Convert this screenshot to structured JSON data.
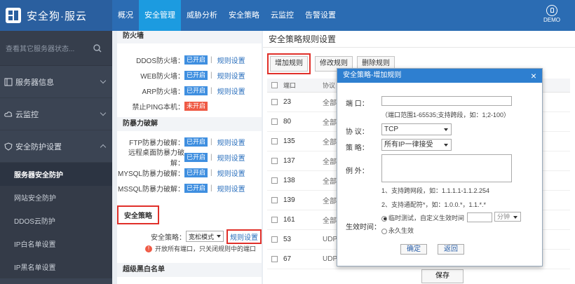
{
  "app": {
    "title": "安全狗·服云"
  },
  "colors": {
    "topbar": "#2b6cb3",
    "active_nav": "#1c9be0",
    "sidebar": "#3b4453",
    "badge_on": "#3f8fe0",
    "badge_off": "#ef5a45",
    "highlight": "#e0302a",
    "modal_head": "#2e7fd0"
  },
  "topnav": [
    "概况",
    "安全管理",
    "威胁分析",
    "安全策略",
    "云监控",
    "告警设置"
  ],
  "user": {
    "label": "DEMO"
  },
  "sidebar": {
    "search_placeholder": "查看其它服务器状态...",
    "items": [
      {
        "label": "服务器信息",
        "icon": "server-icon"
      },
      {
        "label": "云监控",
        "icon": "cloud-icon"
      },
      {
        "label": "安全防护设置",
        "icon": "shield-icon"
      }
    ],
    "sub_items": [
      "服务器安全防护",
      "网站安全防护",
      "DDOS云防护",
      "IP白名单设置",
      "IP黑名单设置"
    ]
  },
  "settings": {
    "firewall_title": "防火墙",
    "firewall_rows": [
      {
        "label": "DDOS防火墙：",
        "status": "已开启",
        "link": "规则设置"
      },
      {
        "label": "WEB防火墙：",
        "status": "已开启",
        "link": "规则设置"
      },
      {
        "label": "ARP防火墙：",
        "status": "已开启",
        "link": "规则设置"
      }
    ],
    "ping_label": "禁止PING本机：",
    "ping_status": "未开启",
    "brute_title": "防暴力破解",
    "brute_rows": [
      {
        "label": "FTP防暴力破解：",
        "status": "已开启",
        "link": "规则设置"
      },
      {
        "label": "远程桌面防暴力破解：",
        "status": "已开启",
        "link": "规则设置"
      },
      {
        "label": "MYSQL防暴力破解：",
        "status": "已开启",
        "link": "规则设置"
      },
      {
        "label": "MSSQL防暴力破解：",
        "status": "已开启",
        "link": "规则设置"
      }
    ],
    "policy_title": "安全策略",
    "policy_label": "安全策略：",
    "policy_value": "宽松模式",
    "policy_link": "规则设置",
    "policy_note": "开放所有端口，只关闭规则中的端口",
    "next_title": "超级黑白名单"
  },
  "rules": {
    "title": "安全策略规则设置",
    "buttons": {
      "add": "增加规则",
      "edit": "修改规则",
      "delete": "删除规则"
    },
    "col_port": "端口",
    "col_proto": "协议",
    "rows": [
      {
        "port": "23",
        "proto": "全部"
      },
      {
        "port": "80",
        "proto": "全部"
      },
      {
        "port": "135",
        "proto": "全部"
      },
      {
        "port": "137",
        "proto": "全部"
      },
      {
        "port": "138",
        "proto": "全部"
      },
      {
        "port": "139",
        "proto": "全部"
      },
      {
        "port": "161",
        "proto": "全部"
      },
      {
        "port": "53",
        "proto": "UDP"
      },
      {
        "port": "67",
        "proto": "UDP"
      }
    ],
    "save": "保存"
  },
  "modal": {
    "title": "安全策略-增加规则",
    "port_label": "端    口：",
    "port_hint": "（端口范围1-65535;支持跨段，如：1;2-100）",
    "proto_label": "协    议：",
    "proto_value": "TCP",
    "policy_label": "策    略：",
    "policy_value": "所有IP一律接受",
    "except_label": "例    外：",
    "except_hint1": "1、支持跨网段，如：1.1.1.1-1.1.2.254",
    "except_hint2": "2、支持通配符*，如：1.0.0.*，1.1.*.*",
    "effective_label": "生效时间：",
    "opt_temp": "临时测试，自定义生效时间",
    "unit": "分钟",
    "opt_perm": "永久生效",
    "ok": "确定",
    "back": "返回"
  }
}
